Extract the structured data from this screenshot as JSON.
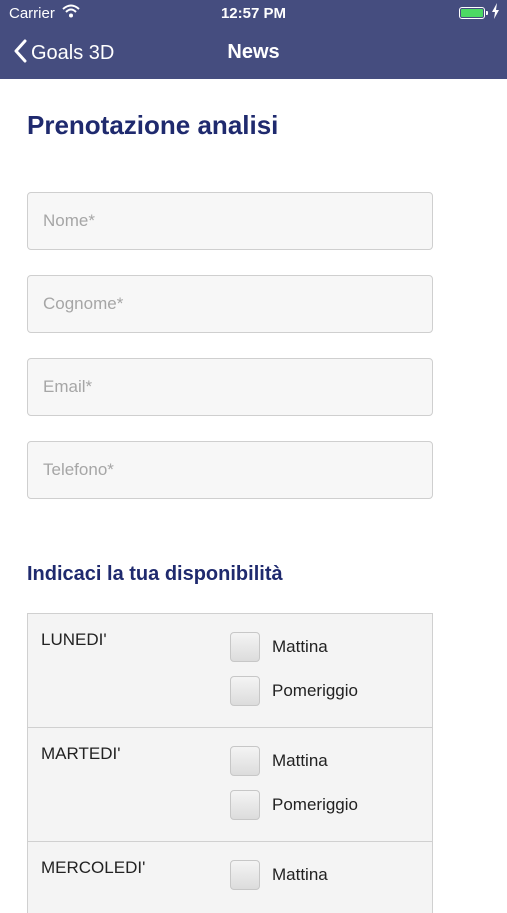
{
  "status_bar": {
    "carrier": "Carrier",
    "time": "12:57 PM",
    "wifi_icon": "wifi-icon",
    "battery_icon": "battery-icon"
  },
  "nav": {
    "back_label": "Goals 3D",
    "title": "News",
    "back_icon": "chevron-left-icon"
  },
  "page": {
    "title": "Prenotazione analisi"
  },
  "form": {
    "nome_placeholder": "Nome*",
    "cognome_placeholder": "Cognome*",
    "email_placeholder": "Email*",
    "telefono_placeholder": "Telefono*"
  },
  "availability": {
    "title": "Indicaci la tua disponibilità",
    "days": [
      {
        "name": "LUNEDI'",
        "slots": [
          "Mattina",
          "Pomeriggio"
        ]
      },
      {
        "name": "MARTEDI'",
        "slots": [
          "Mattina",
          "Pomeriggio"
        ]
      },
      {
        "name": "MERCOLEDI'",
        "slots": [
          "Mattina"
        ]
      }
    ]
  },
  "colors": {
    "nav_background": "#454d7f",
    "title_blue": "#1f2a6e",
    "battery_green": "#4cd964"
  }
}
